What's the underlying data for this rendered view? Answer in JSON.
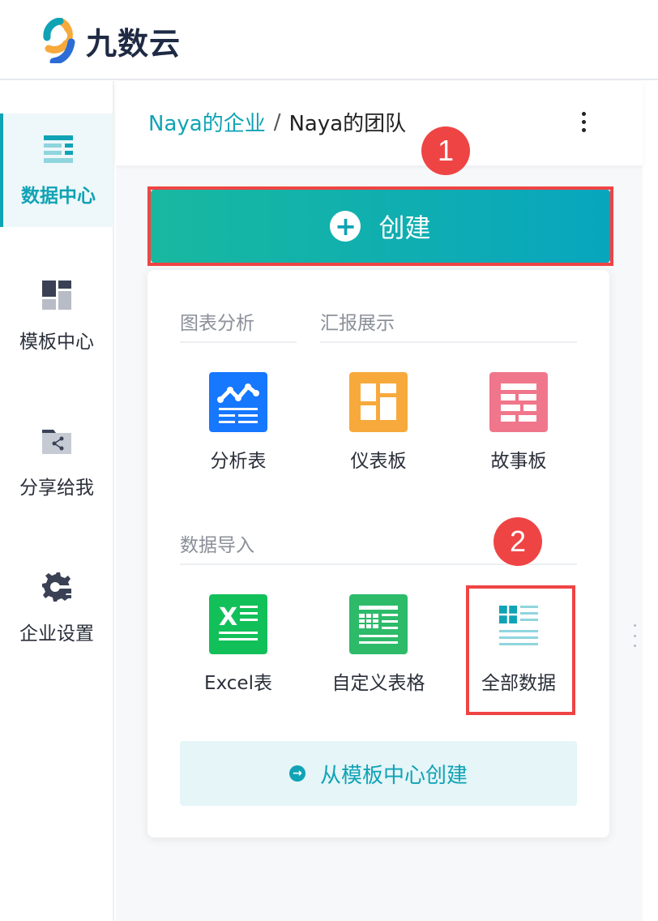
{
  "header": {
    "logo_text": "九数云"
  },
  "sidebar": {
    "items": [
      {
        "label": "数据中心",
        "icon": "data-center-icon",
        "active": true
      },
      {
        "label": "模板中心",
        "icon": "template-center-icon",
        "active": false
      },
      {
        "label": "分享给我",
        "icon": "shared-with-me-icon",
        "active": false
      },
      {
        "label": "企业设置",
        "icon": "enterprise-settings-icon",
        "active": false
      }
    ]
  },
  "breadcrumb": {
    "enterprise": "Naya的企业",
    "separator": "/",
    "team": "Naya的团队"
  },
  "markers": [
    "1",
    "2"
  ],
  "create_button": {
    "label": "创建"
  },
  "panel": {
    "sections": {
      "chart_analysis": "图表分析",
      "report_display": "汇报展示",
      "data_import": "数据导入"
    },
    "tiles": {
      "analysis_table": "分析表",
      "dashboard": "仪表板",
      "storyboard": "故事板",
      "excel_table": "Excel表",
      "custom_table": "自定义表格",
      "all_data": "全部数据"
    },
    "template_button": "从模板中心创建"
  },
  "colors": {
    "brand": "#10a3b5",
    "highlight": "#ef4444",
    "analysis_blue": "#1677ff",
    "dashboard_orange": "#f7a93b",
    "storyboard_pink": "#f0768b",
    "excel_green": "#12c05a",
    "custom_green": "#2dbb6a"
  }
}
